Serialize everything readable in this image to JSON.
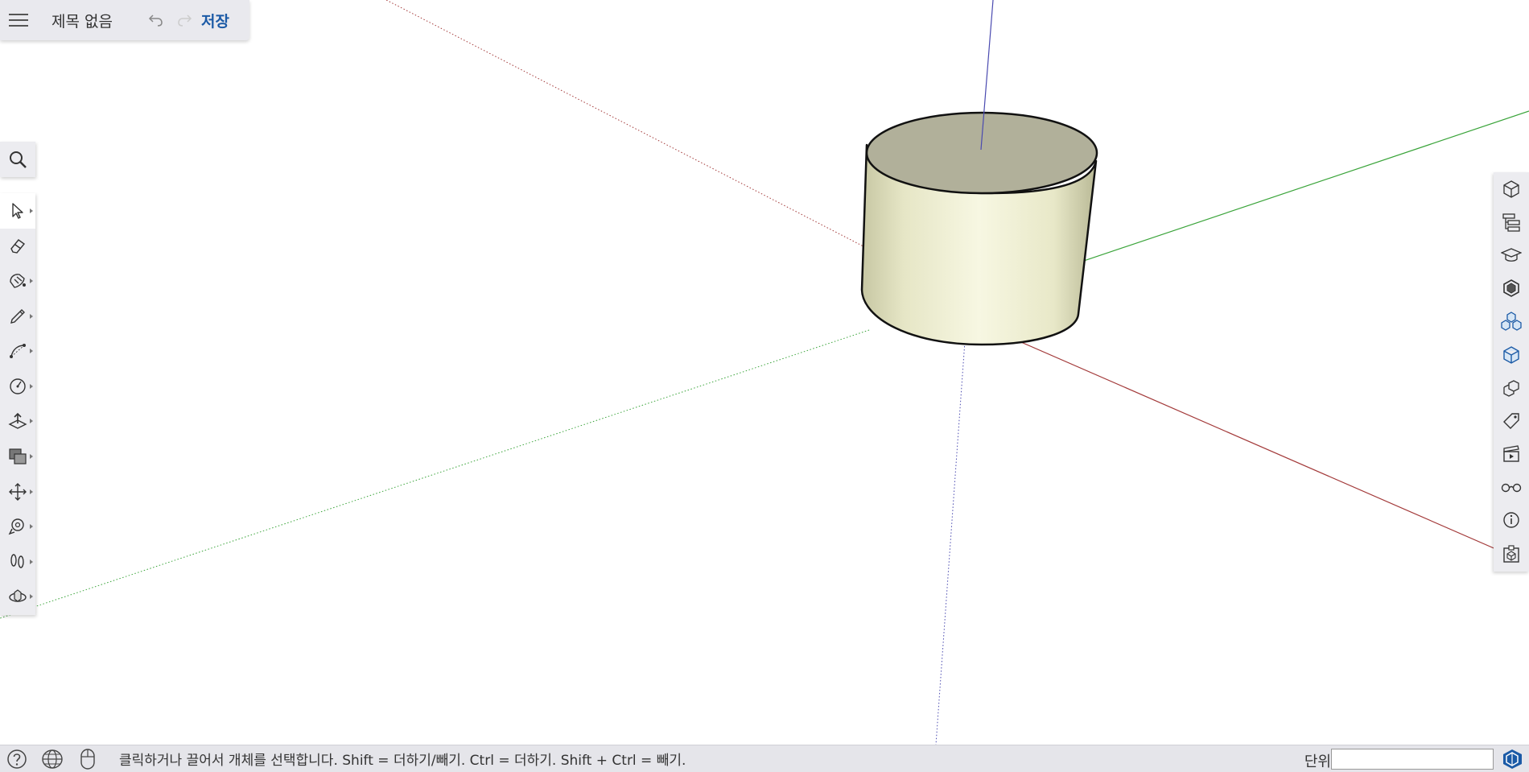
{
  "header": {
    "menu_icon": "hamburger-menu-icon",
    "title": "제목 없음",
    "undo_icon": "undo-icon",
    "redo_icon": "redo-icon",
    "save_label": "저장"
  },
  "search": {
    "icon": "search-icon"
  },
  "tools": [
    {
      "name": "select",
      "icon": "select-arrow-icon",
      "active": true,
      "has_submenu": true
    },
    {
      "name": "eraser",
      "icon": "eraser-icon",
      "active": false,
      "has_submenu": false
    },
    {
      "name": "paint",
      "icon": "paint-bucket-icon",
      "active": false,
      "has_submenu": true
    },
    {
      "name": "line",
      "icon": "pencil-icon",
      "active": false,
      "has_submenu": true
    },
    {
      "name": "arc",
      "icon": "arc-icon",
      "active": false,
      "has_submenu": true
    },
    {
      "name": "circle",
      "icon": "circle-icon",
      "active": false,
      "has_submenu": true
    },
    {
      "name": "push-pull",
      "icon": "push-pull-icon",
      "active": false,
      "has_submenu": true
    },
    {
      "name": "offset",
      "icon": "offset-icon",
      "active": false,
      "has_submenu": true
    },
    {
      "name": "move",
      "icon": "move-icon",
      "active": false,
      "has_submenu": true
    },
    {
      "name": "tape-measure",
      "icon": "tape-measure-icon",
      "active": false,
      "has_submenu": true
    },
    {
      "name": "walk",
      "icon": "footprints-icon",
      "active": false,
      "has_submenu": true
    },
    {
      "name": "orbit",
      "icon": "orbit-icon",
      "active": false,
      "has_submenu": true
    }
  ],
  "panels": [
    {
      "icon": "entity-info-cube-icon",
      "accent": false
    },
    {
      "icon": "outliner-icon",
      "accent": false
    },
    {
      "icon": "instructor-icon",
      "accent": false
    },
    {
      "icon": "styles-icon",
      "accent": false
    },
    {
      "icon": "components-icon",
      "accent": true
    },
    {
      "icon": "materials-icon",
      "accent": true
    },
    {
      "icon": "solid-inspector-icon",
      "accent": false
    },
    {
      "icon": "tags-icon",
      "accent": false
    },
    {
      "icon": "scenes-icon",
      "accent": false
    },
    {
      "icon": "display-glasses-icon",
      "accent": false
    },
    {
      "icon": "info-icon",
      "accent": false
    },
    {
      "icon": "model-export-icon",
      "accent": false
    }
  ],
  "status": {
    "help_icon": "help-icon",
    "globe_icon": "globe-icon",
    "mouse_icon": "mouse-icon",
    "message": "클릭하거나 끌어서 개체를 선택합니다. Shift = 더하기/빼기. Ctrl = 더하기. Shift + Ctrl = 빼기.",
    "units_label": "단위",
    "units_value": "",
    "logo_icon": "sketchup-logo-icon"
  },
  "colors": {
    "accent": "#1b5aa6",
    "axis_red": "#a33a3a",
    "axis_green": "#3aa43a",
    "axis_blue": "#4a4ab0",
    "cylinder_top": "#b1b09a",
    "cylinder_side": "#f1f1d6"
  }
}
